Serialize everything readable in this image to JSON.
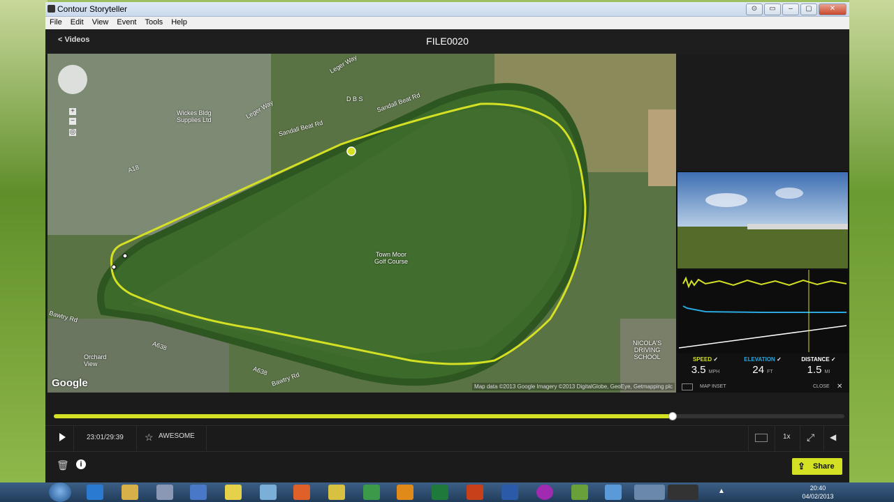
{
  "window": {
    "title": "Contour Storyteller",
    "buttons": [
      "⊙",
      "▭",
      "–",
      "▢",
      "✕"
    ]
  },
  "menu": [
    "File",
    "Edit",
    "View",
    "Event",
    "Tools",
    "Help"
  ],
  "header": {
    "back_label": "< Videos",
    "file_title": "FILE0020"
  },
  "map": {
    "labels": {
      "leger_way": "Leger Way",
      "leger_way_2": "Leger Way",
      "sandall_beat": "Sandall Beat Rd",
      "sandall_beat_2": "Sandall Beat Rd",
      "wickes": "Wickes Bldg\nSupplies Ltd",
      "dbs": "D B S",
      "town_moor": "Town Moor\nGolf Course",
      "a18": "A18",
      "a638": "A638",
      "a638_2": "A638",
      "bawtry": "Bawtry Rd",
      "bawtry_2": "Bawtry Rd",
      "orchard": "Orchard\nView",
      "nicolas": "NICOLA'S\nDRIVING\nSCHOOL"
    },
    "google": "Google",
    "credit": "Map data ©2013 Google Imagery ©2013 DigitalGlobe, GeoEye, Getmapping plc",
    "track_color": "#d4e024"
  },
  "inset": {
    "stats": [
      {
        "label": "SPEED",
        "value": "3.5",
        "unit": "MPH",
        "color": "#d4e024"
      },
      {
        "label": "ELEVATION",
        "value": "24",
        "unit": "FT",
        "color": "#2aa8e0"
      },
      {
        "label": "DISTANCE",
        "value": "1.5",
        "unit": "MI",
        "color": "#ffffff"
      }
    ],
    "check": "✓",
    "map_inset_label": "MAP INSET",
    "close_label": "CLOSE",
    "close_icon": "✕"
  },
  "playback": {
    "progress": 0.7815,
    "time": "23:01/29:39",
    "awesome_label": "AWESOME",
    "speed": "1x"
  },
  "share_label": "Share",
  "taskbar": {
    "clock_time": "20:40",
    "clock_date": "04/02/2013"
  }
}
